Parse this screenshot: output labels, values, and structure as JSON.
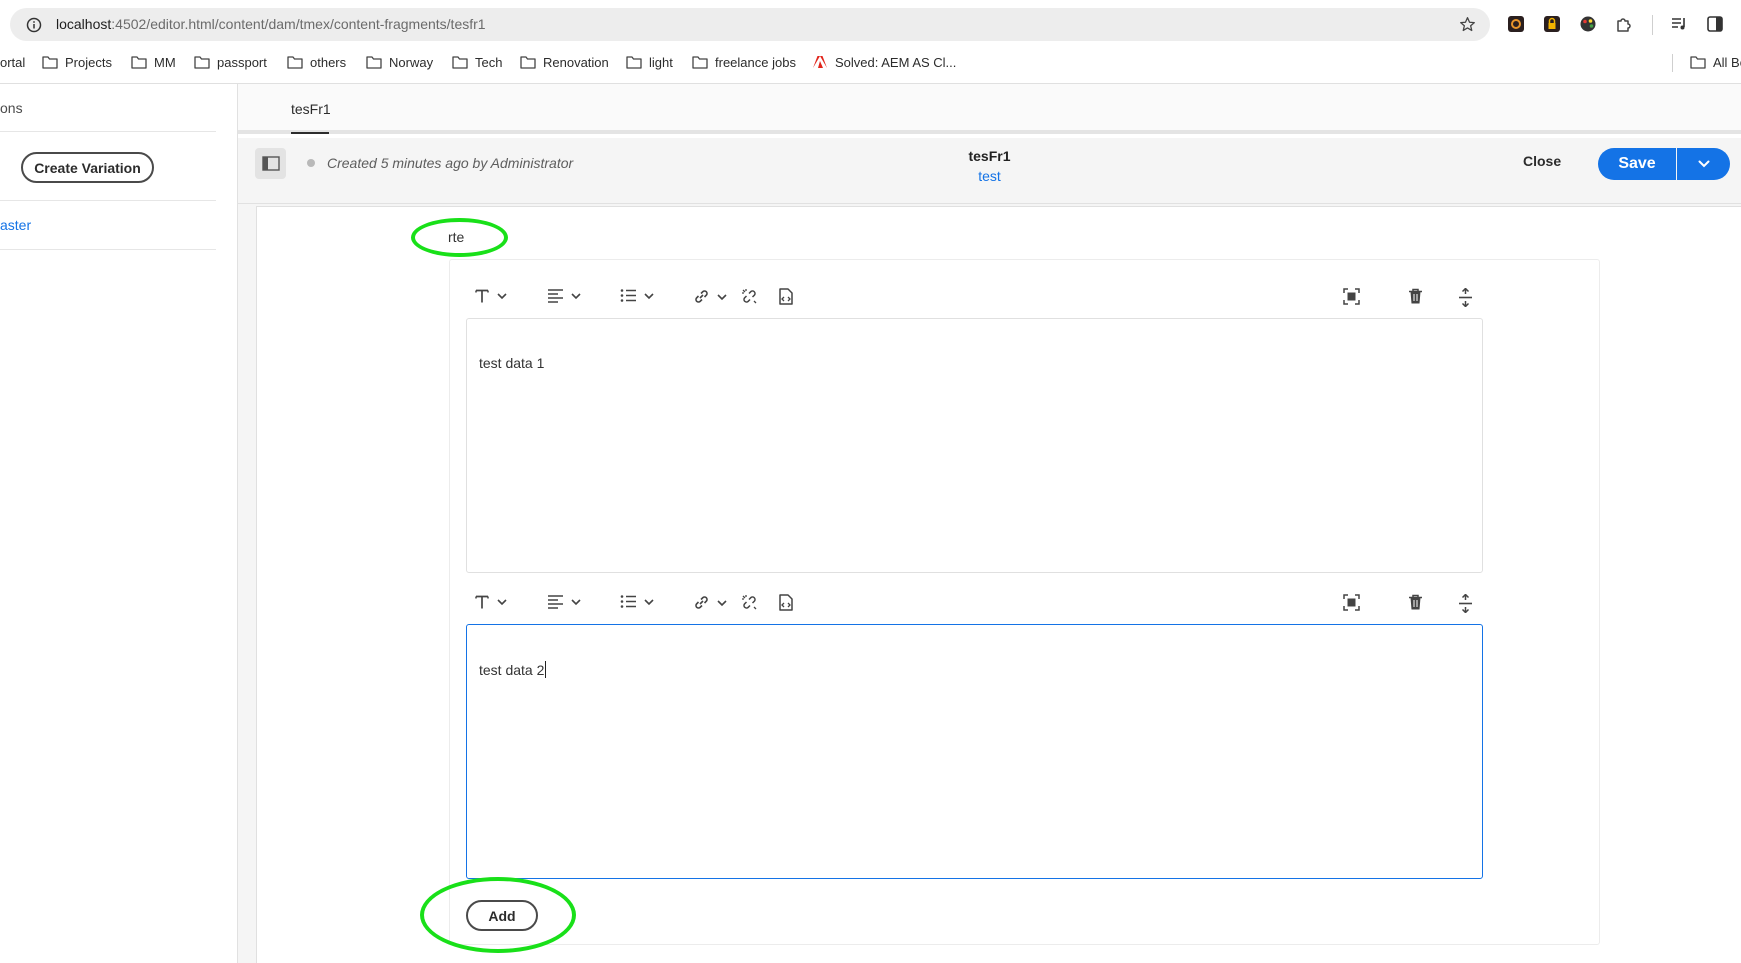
{
  "browser": {
    "url_host": "localhost",
    "url_rest": ":4502/editor.html/content/dam/tmex/content-fragments/tesfr1",
    "bookmarks": [
      {
        "label": "ortal",
        "icon": "none"
      },
      {
        "label": "Projects",
        "icon": "folder-icon"
      },
      {
        "label": "MM",
        "icon": "folder-icon"
      },
      {
        "label": "passport",
        "icon": "folder-icon"
      },
      {
        "label": "others",
        "icon": "folder-icon"
      },
      {
        "label": "Norway",
        "icon": "folder-icon"
      },
      {
        "label": "Tech",
        "icon": "folder-icon"
      },
      {
        "label": "Renovation",
        "icon": "folder-icon"
      },
      {
        "label": "light",
        "icon": "folder-icon"
      },
      {
        "label": "freelance jobs",
        "icon": "folder-icon"
      },
      {
        "label": "Solved: AEM AS Cl...",
        "icon": "adobe-icon"
      },
      {
        "label": "All Bo",
        "icon": "folder-icon"
      }
    ]
  },
  "left_rail": {
    "heading": "ons",
    "create_variation_label": "Create Variation",
    "master_link": "aster"
  },
  "editor": {
    "tab_label": "tesFr1",
    "status_text": "Created 5 minutes ago by Administrator",
    "fragment_title": "tesFr1",
    "fragment_subtitle": "test",
    "close_label": "Close",
    "save_label": "Save"
  },
  "field": {
    "label": "rte",
    "entries": [
      {
        "text": "test data 1"
      },
      {
        "text": "test data 2"
      }
    ],
    "add_label": "Add"
  },
  "colors": {
    "accent": "#1473e6",
    "annotation": "#19e019"
  }
}
